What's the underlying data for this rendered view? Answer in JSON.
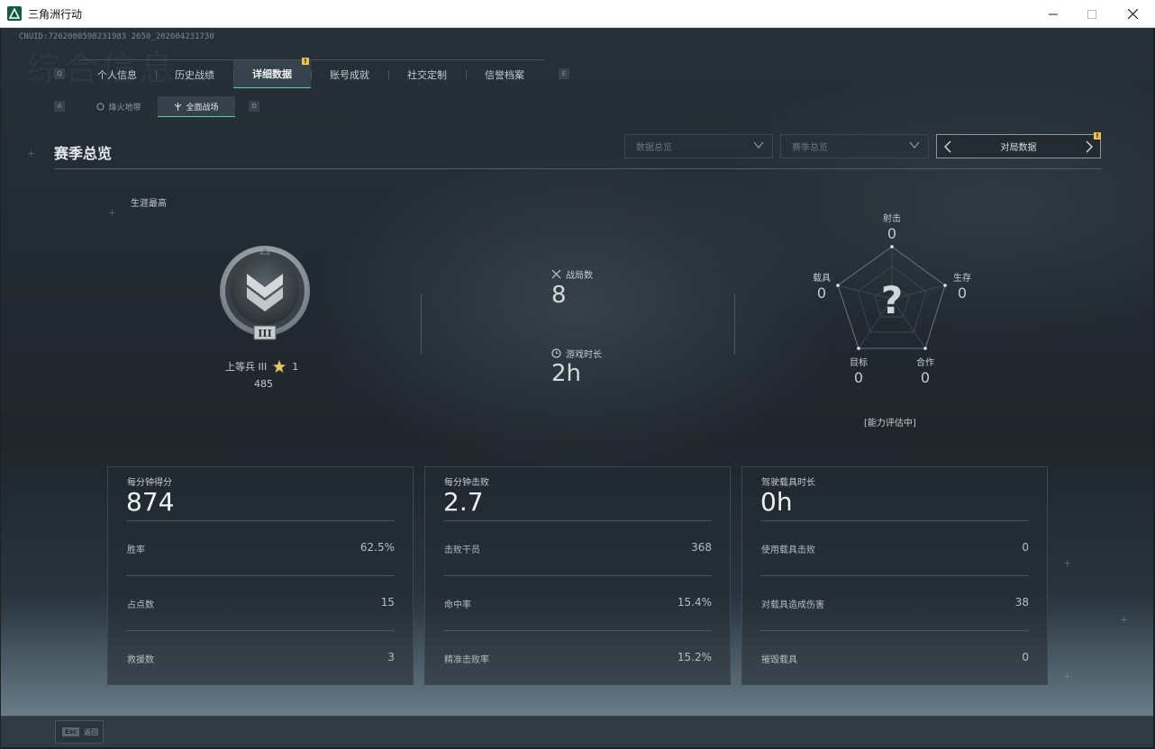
{
  "window": {
    "title": "三角洲行动"
  },
  "header": {
    "bg_title": "综合信息",
    "cnuid": "CNUID:7262000598231983 2650_202604231730"
  },
  "top_tabs": {
    "key_left": "Q",
    "key_right": "E",
    "items": [
      {
        "label": "个人信息"
      },
      {
        "label": "历史战绩"
      },
      {
        "label": "详细数据"
      },
      {
        "label": "账号成就"
      },
      {
        "label": "社交定制"
      },
      {
        "label": "信誉档案"
      }
    ],
    "active_badge": "!"
  },
  "sub_tabs": {
    "key_left": "A",
    "key_right": "D",
    "items": [
      {
        "label": "烽火地带"
      },
      {
        "label": "全面战场"
      }
    ]
  },
  "section": {
    "title": "赛季总览",
    "dropdown_1": "数据总览",
    "dropdown_2": "赛季总览",
    "pager_label": "对局数据",
    "pager_badge": "!"
  },
  "career": {
    "label": "生涯最高",
    "rank_name": "上等兵 III",
    "stars": "1",
    "score": "485",
    "rank_tier": "III"
  },
  "stats": {
    "matches_label": "战局数",
    "matches_value": "8",
    "playtime_label": "游戏时长",
    "playtime_value": "2h"
  },
  "radar": {
    "axes": [
      {
        "label": "射击",
        "value": "0"
      },
      {
        "label": "生存",
        "value": "0"
      },
      {
        "label": "合作",
        "value": "0"
      },
      {
        "label": "目标",
        "value": "0"
      },
      {
        "label": "载具",
        "value": "0"
      }
    ],
    "center_mark": "?",
    "note": "[能力评估中]"
  },
  "cards": [
    {
      "title": "每分钟得分",
      "value": "874",
      "rows": [
        {
          "label": "胜率",
          "value": "62.5%"
        },
        {
          "label": "占点数",
          "value": "15"
        },
        {
          "label": "救援数",
          "value": "3"
        }
      ]
    },
    {
      "title": "每分钟击败",
      "value": "2.7",
      "rows": [
        {
          "label": "击败干员",
          "value": "368"
        },
        {
          "label": "命中率",
          "value": "15.4%"
        },
        {
          "label": "精准击败率",
          "value": "15.2%"
        }
      ]
    },
    {
      "title": "驾驶载具时长",
      "value": "0h",
      "rows": [
        {
          "label": "使用载具击败",
          "value": "0"
        },
        {
          "label": "对载具造成伤害",
          "value": "38"
        },
        {
          "label": "摧毁载具",
          "value": "0"
        }
      ]
    }
  ],
  "bottom": {
    "esc_key": "Esc",
    "esc_label": "返回"
  }
}
